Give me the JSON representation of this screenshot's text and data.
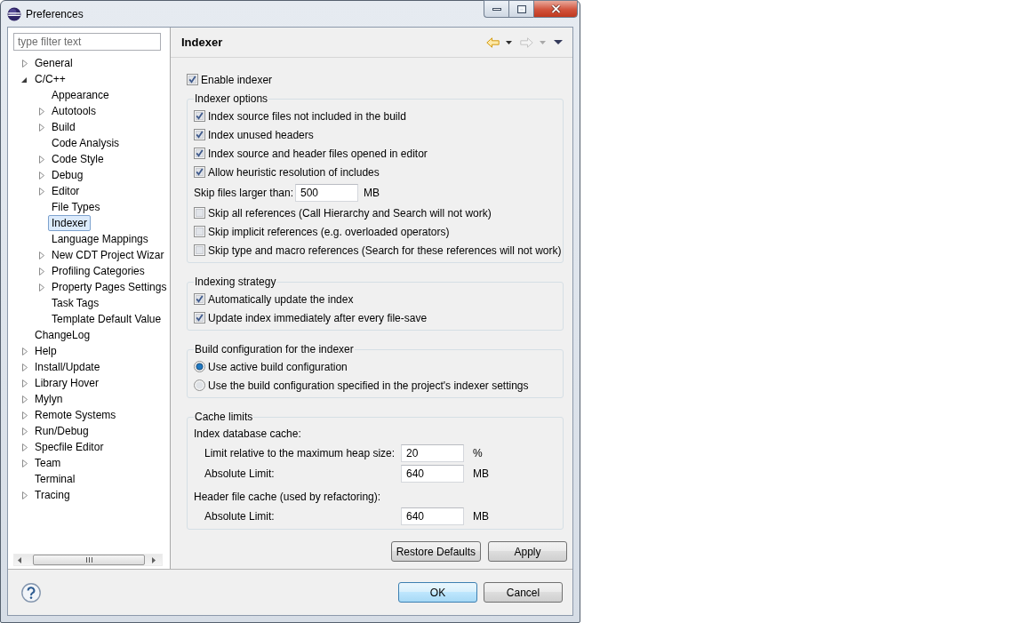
{
  "window": {
    "title": "Preferences"
  },
  "filter": {
    "placeholder": "type filter text"
  },
  "tree": [
    {
      "label": "General",
      "kind": "collapsed",
      "selected": false
    },
    {
      "label": "C/C++",
      "kind": "expanded",
      "selected": false,
      "children": [
        {
          "label": "Appearance",
          "kind": "leaf",
          "selected": false
        },
        {
          "label": "Autotools",
          "kind": "collapsed",
          "selected": false
        },
        {
          "label": "Build",
          "kind": "collapsed",
          "selected": false
        },
        {
          "label": "Code Analysis",
          "kind": "leaf",
          "selected": false
        },
        {
          "label": "Code Style",
          "kind": "collapsed",
          "selected": false
        },
        {
          "label": "Debug",
          "kind": "collapsed",
          "selected": false
        },
        {
          "label": "Editor",
          "kind": "collapsed",
          "selected": false
        },
        {
          "label": "File Types",
          "kind": "leaf",
          "selected": false
        },
        {
          "label": "Indexer",
          "kind": "leaf",
          "selected": true
        },
        {
          "label": "Language Mappings",
          "kind": "leaf",
          "selected": false
        },
        {
          "label": "New CDT Project Wizar",
          "kind": "collapsed",
          "selected": false
        },
        {
          "label": "Profiling Categories",
          "kind": "collapsed",
          "selected": false
        },
        {
          "label": "Property Pages Settings",
          "kind": "collapsed",
          "selected": false
        },
        {
          "label": "Task Tags",
          "kind": "leaf",
          "selected": false
        },
        {
          "label": "Template Default Value",
          "kind": "leaf",
          "selected": false
        }
      ]
    },
    {
      "label": "ChangeLog",
      "kind": "leaf",
      "selected": false
    },
    {
      "label": "Help",
      "kind": "collapsed",
      "selected": false
    },
    {
      "label": "Install/Update",
      "kind": "collapsed",
      "selected": false
    },
    {
      "label": "Library Hover",
      "kind": "collapsed",
      "selected": false
    },
    {
      "label": "Mylyn",
      "kind": "collapsed",
      "selected": false
    },
    {
      "label": "Remote Systems",
      "kind": "collapsed",
      "selected": false
    },
    {
      "label": "Run/Debug",
      "kind": "collapsed",
      "selected": false
    },
    {
      "label": "Specfile Editor",
      "kind": "collapsed",
      "selected": false
    },
    {
      "label": "Team",
      "kind": "collapsed",
      "selected": false
    },
    {
      "label": "Terminal",
      "kind": "leaf",
      "selected": false
    },
    {
      "label": "Tracing",
      "kind": "collapsed",
      "selected": false
    }
  ],
  "page": {
    "title": "Indexer"
  },
  "navigation": {
    "back": {
      "disabled": false
    },
    "forward": {
      "disabled": true
    }
  },
  "enable_indexer": {
    "label": "Enable indexer",
    "checked": true
  },
  "groups": [
    {
      "title": "Indexer options",
      "items": [
        {
          "kind": "checkbox",
          "label": "Index source files not included in the build",
          "checked": true
        },
        {
          "kind": "checkbox",
          "label": "Index unused headers",
          "checked": true
        },
        {
          "kind": "checkbox",
          "label": "Index source and header files opened in editor",
          "checked": true
        },
        {
          "kind": "checkbox",
          "label": "Allow heuristic resolution of includes",
          "checked": true
        },
        {
          "kind": "field",
          "label": "Skip files larger than:",
          "value": "500",
          "unit": "MB"
        },
        {
          "kind": "checkbox",
          "label": "Skip all references (Call Hierarchy and Search will not work)",
          "checked": false
        },
        {
          "kind": "checkbox",
          "label": "Skip implicit references (e.g. overloaded operators)",
          "checked": false
        },
        {
          "kind": "checkbox",
          "label": "Skip type and macro references (Search for these references will not work)",
          "checked": false
        }
      ]
    },
    {
      "title": "Indexing strategy",
      "items": [
        {
          "kind": "checkbox",
          "label": "Automatically update the index",
          "checked": true
        },
        {
          "kind": "checkbox",
          "label": "Update index immediately after every file-save",
          "checked": true
        }
      ]
    },
    {
      "title": "Build configuration for the indexer",
      "items": [
        {
          "kind": "radio",
          "label": "Use active build configuration",
          "selected": true
        },
        {
          "kind": "radio",
          "label": "Use the build configuration specified in the project's indexer settings",
          "selected": false
        }
      ]
    },
    {
      "title": "Cache limits",
      "items": [
        {
          "kind": "heading",
          "label": "Index database cache:"
        },
        {
          "kind": "subfield",
          "label": "Limit relative to the maximum heap size:",
          "value": "20",
          "unit": "%"
        },
        {
          "kind": "subfield",
          "label": "Absolute Limit:",
          "value": "640",
          "unit": "MB"
        },
        {
          "kind": "heading",
          "label": "Header file cache (used by refactoring):"
        },
        {
          "kind": "subfield",
          "label": "Absolute Limit:",
          "value": "640",
          "unit": "MB"
        }
      ]
    }
  ],
  "page_buttons": [
    {
      "label": "Restore Defaults"
    },
    {
      "label": "Apply"
    }
  ],
  "dialog_buttons": [
    {
      "label": "OK",
      "default": true
    },
    {
      "label": "Cancel",
      "default": false
    }
  ]
}
